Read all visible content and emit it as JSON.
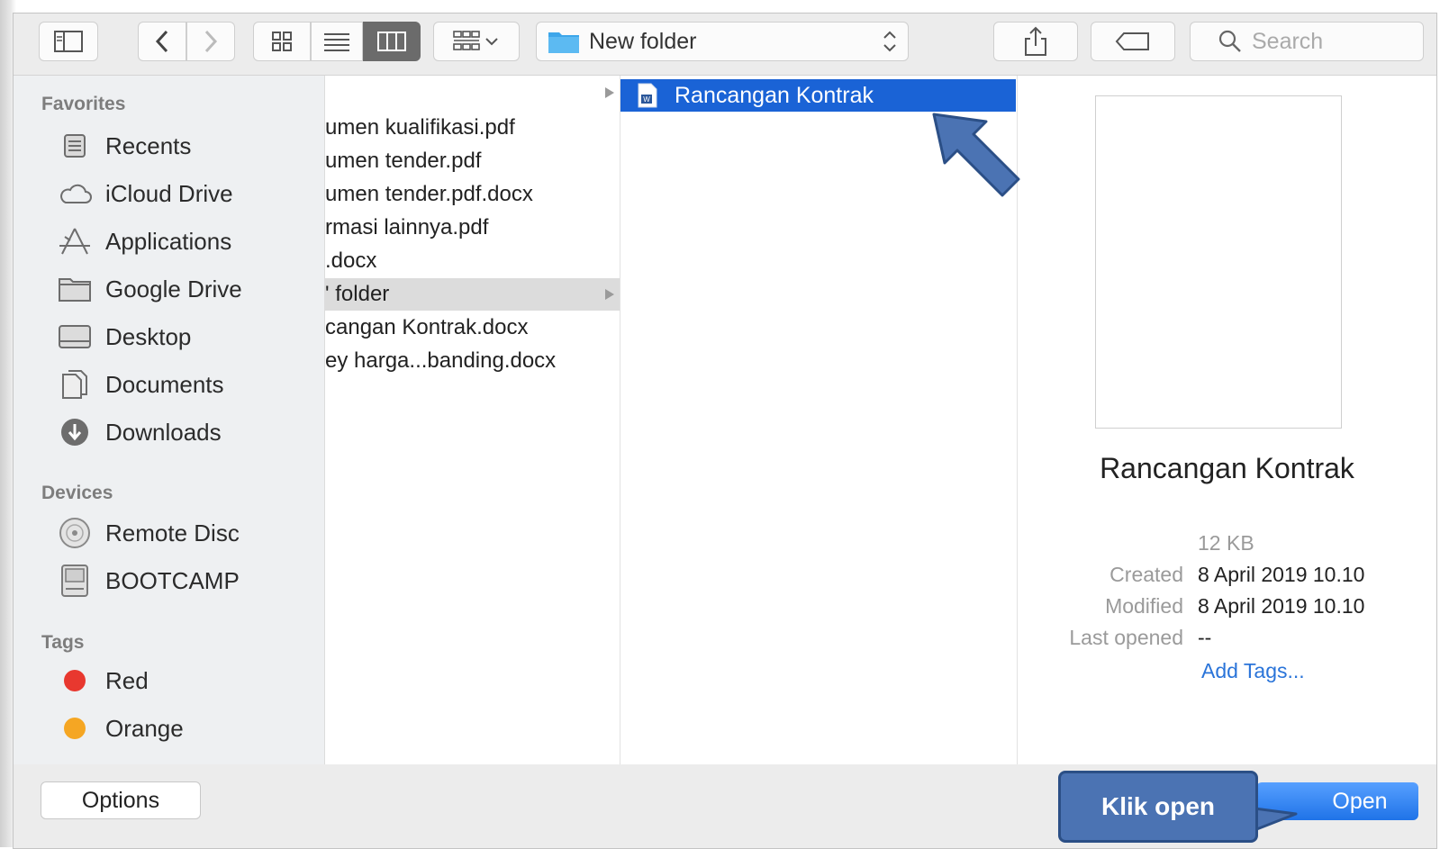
{
  "toolbar": {
    "path_label": "New folder",
    "search_placeholder": "Search"
  },
  "sidebar": {
    "favorites_heading": "Favorites",
    "favorites": [
      {
        "label": "Recents",
        "icon": "recents-icon"
      },
      {
        "label": "iCloud Drive",
        "icon": "cloud-icon"
      },
      {
        "label": "Applications",
        "icon": "applications-icon"
      },
      {
        "label": "Google Drive",
        "icon": "folder-icon"
      },
      {
        "label": "Desktop",
        "icon": "desktop-icon"
      },
      {
        "label": "Documents",
        "icon": "documents-icon"
      },
      {
        "label": "Downloads",
        "icon": "downloads-icon"
      }
    ],
    "devices_heading": "Devices",
    "devices": [
      {
        "label": "Remote Disc",
        "icon": "disc-icon"
      },
      {
        "label": "BOOTCAMP",
        "icon": "drive-icon"
      }
    ],
    "tags_heading": "Tags",
    "tags": [
      {
        "label": "Red",
        "color": "#e8382f"
      },
      {
        "label": "Orange",
        "color": "#f5a623"
      }
    ]
  },
  "column1": {
    "items": [
      "umen kualifikasi.pdf",
      "umen tender.pdf",
      "umen tender.pdf.docx",
      "rmasi lainnya.pdf",
      ".docx",
      "' folder",
      "cangan Kontrak.docx",
      "ey harga...banding.docx"
    ]
  },
  "column2": {
    "selected_item": "Rancangan Kontrak"
  },
  "preview": {
    "title": "Rancangan Kontrak",
    "size": "12 KB",
    "created_label": "Created",
    "created_value": "8 April 2019 10.10",
    "modified_label": "Modified",
    "modified_value": "8 April 2019 10.10",
    "last_opened_label": "Last opened",
    "last_opened_value": "--",
    "add_tags": "Add Tags..."
  },
  "bottom": {
    "options_label": "Options",
    "open_label": "Open",
    "callout_label": "Klik open"
  },
  "colors": {
    "selection": "#1a63d6",
    "annotation": "#4b73b3"
  }
}
